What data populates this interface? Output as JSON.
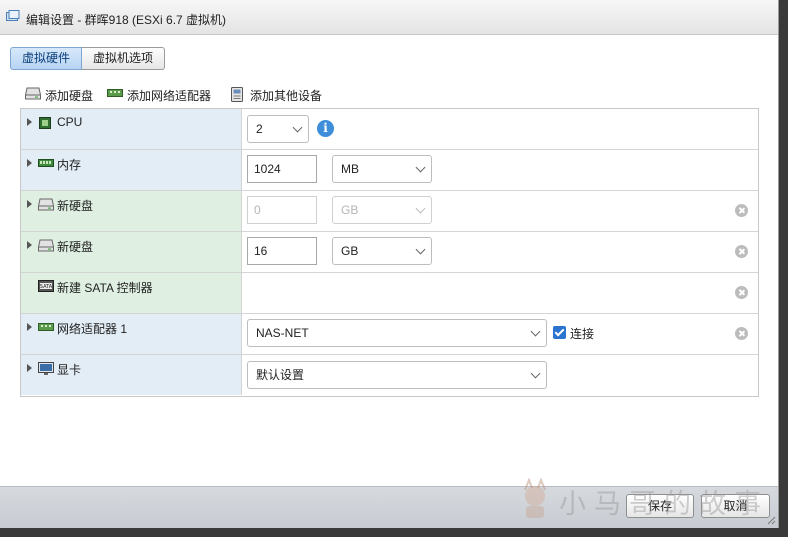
{
  "window": {
    "title": "编辑设置 - 群晖918 (ESXi 6.7 虚拟机)",
    "title_icon": "vm-icon"
  },
  "tabs": [
    {
      "label": "虚拟硬件",
      "active": true
    },
    {
      "label": "虚拟机选项",
      "active": false
    }
  ],
  "toolbar": {
    "add_disk": "添加硬盘",
    "add_network": "添加网络适配器",
    "add_other": "添加其他设备"
  },
  "rows": {
    "cpu": {
      "label": "CPU",
      "value": "2",
      "icon": "cpu-icon"
    },
    "memory": {
      "label": "内存",
      "value": "1024",
      "unit": "MB",
      "icon": "memory-icon"
    },
    "disk1": {
      "label": "新硬盘",
      "value": "0",
      "unit": "GB",
      "disabled": true,
      "icon": "disk-icon"
    },
    "disk2": {
      "label": "新硬盘",
      "value": "16",
      "unit": "GB",
      "icon": "disk-icon"
    },
    "sata": {
      "label": "新建 SATA 控制器",
      "icon": "sata-icon"
    },
    "network": {
      "label": "网络适配器 1",
      "value": "NAS-NET",
      "connect_label": "连接",
      "connected": true,
      "icon": "network-adapter-icon"
    },
    "video": {
      "label": "显卡",
      "value": "默认设置",
      "icon": "monitor-icon"
    }
  },
  "footer": {
    "save": "保存",
    "cancel": "取消"
  },
  "watermark": {
    "text": "小马哥的故事"
  },
  "colors": {
    "accent": "#2a74d0",
    "label_bg": "#e3edf6",
    "new_label_bg": "#dff0e3",
    "footer_bg": "#cfd3d8"
  }
}
